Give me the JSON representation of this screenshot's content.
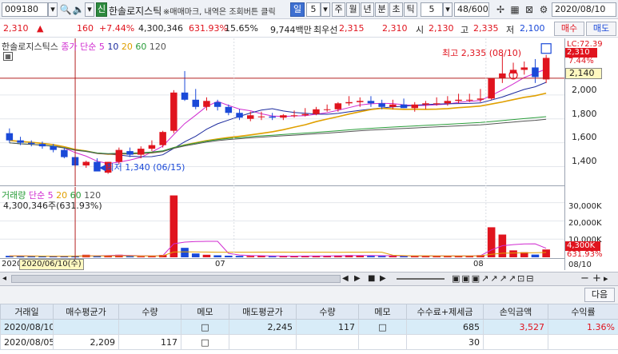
{
  "toolbar": {
    "code": "009180",
    "badge": "신",
    "name": "한솔로지스틱",
    "notice": "※매매마크, 내역은 조회버튼 클릭",
    "periods": [
      "일",
      "5",
      "주",
      "월",
      "년",
      "분",
      "초",
      "틱"
    ],
    "active_period": "일",
    "tick_value": "5",
    "count": "48/600",
    "date": "2020/08/10"
  },
  "price_row": {
    "price": "2,310",
    "arrow": "▲",
    "change": "160",
    "change_pct": "+7.44%",
    "volume": "4,300,346",
    "vol_pct": "631.93%",
    "turnover": "15.65%",
    "amount": "9,744백만",
    "best_ask_label": "최우선",
    "best_ask": "2,315",
    "best_bid": "2,310",
    "open_label": "시",
    "open": "2,130",
    "high_label": "고",
    "high": "2,335",
    "low_label": "저",
    "low": "2,100",
    "buy_btn": "매수",
    "sell_btn": "매도"
  },
  "price_pane": {
    "legend_name": "한솔로지스틱스",
    "legend_ma": "종가 단순",
    "ma_periods": [
      "5",
      "10",
      "20",
      "60",
      "120"
    ],
    "ma_colors": [
      "#d02bd0",
      "#1c2b9e",
      "#e0a000",
      "#2a9d3a",
      "#555555"
    ],
    "high_note": "최고 2,335 (08/10)",
    "low_note": "최저 1,340 (06/15)",
    "right_labels": {
      "lc": "LC:72.39",
      "cur": "2,310",
      "pct": "7.44%",
      "ref": "2,140"
    },
    "axis_ticks": [
      "2,000",
      "1,800",
      "1,600",
      "1,400"
    ]
  },
  "vol_pane": {
    "legend_name": "거래량",
    "legend_ma": "단순",
    "ma_periods": [
      "5",
      "20",
      "60",
      "120"
    ],
    "ma_colors": [
      "#d02bd0",
      "#e0a000",
      "#2a9d3a",
      "#555555"
    ],
    "cur_text": "4,300,346주(631.93%)",
    "axis_ticks": [
      "30,000K",
      "20,000K",
      "10,000K"
    ],
    "right_labels": {
      "cur": "4,300K",
      "pct": "631.93%"
    }
  },
  "time_axis": {
    "labels": [
      "2020",
      "07",
      "08"
    ],
    "cursor": "2020/06/10(수)",
    "right": "08/10"
  },
  "chart_data": {
    "type": "candlestick",
    "dates": [
      "06/02",
      "06/03",
      "06/04",
      "06/05",
      "06/08",
      "06/09",
      "06/10",
      "06/11",
      "06/12",
      "06/15",
      "06/16",
      "06/17",
      "06/18",
      "06/19",
      "06/22",
      "06/23",
      "06/24",
      "06/25",
      "06/26",
      "06/29",
      "06/30",
      "07/01",
      "07/02",
      "07/03",
      "07/06",
      "07/07",
      "07/08",
      "07/09",
      "07/10",
      "07/13",
      "07/14",
      "07/15",
      "07/16",
      "07/17",
      "07/20",
      "07/21",
      "07/22",
      "07/23",
      "07/24",
      "07/27",
      "07/28",
      "07/29",
      "07/30",
      "07/31",
      "08/03",
      "08/04",
      "08/05",
      "08/06",
      "08/07",
      "08/10"
    ],
    "open": [
      1680,
      1620,
      1600,
      1590,
      1570,
      1540,
      1480,
      1410,
      1440,
      1350,
      1440,
      1530,
      1500,
      1550,
      1580,
      1700,
      2020,
      1960,
      1900,
      1940,
      1900,
      1850,
      1800,
      1820,
      1820,
      1810,
      1830,
      1830,
      1840,
      1880,
      1880,
      1930,
      1940,
      1950,
      1930,
      1900,
      1920,
      1890,
      1920,
      1930,
      1930,
      1950,
      1960,
      1960,
      1970,
      2140,
      2180,
      2210,
      2230,
      2130
    ],
    "high": [
      1720,
      1650,
      1620,
      1610,
      1590,
      1560,
      1500,
      1450,
      1470,
      1440,
      1560,
      1560,
      1570,
      1620,
      1700,
      2040,
      2200,
      2050,
      1980,
      1960,
      1920,
      1880,
      1860,
      1860,
      1850,
      1840,
      1870,
      1890,
      1900,
      1920,
      1940,
      1990,
      1980,
      1990,
      1960,
      1960,
      1970,
      1940,
      1950,
      1980,
      1990,
      2010,
      2010,
      2050,
      2140,
      2340,
      2270,
      2280,
      2300,
      2335
    ],
    "low": [
      1600,
      1580,
      1570,
      1550,
      1520,
      1470,
      1400,
      1390,
      1380,
      1340,
      1420,
      1480,
      1470,
      1530,
      1560,
      1680,
      1950,
      1880,
      1870,
      1870,
      1830,
      1790,
      1780,
      1790,
      1790,
      1790,
      1810,
      1820,
      1830,
      1860,
      1860,
      1910,
      1900,
      1900,
      1880,
      1880,
      1890,
      1860,
      1880,
      1910,
      1910,
      1930,
      1940,
      1940,
      1960,
      2100,
      2140,
      2170,
      2100,
      2100
    ],
    "close": [
      1620,
      1600,
      1590,
      1570,
      1540,
      1480,
      1410,
      1440,
      1360,
      1440,
      1540,
      1500,
      1550,
      1580,
      1690,
      2020,
      1960,
      1900,
      1950,
      1900,
      1850,
      1810,
      1830,
      1820,
      1810,
      1830,
      1830,
      1840,
      1880,
      1880,
      1930,
      1940,
      1950,
      1930,
      1900,
      1920,
      1890,
      1920,
      1930,
      1930,
      1950,
      1960,
      1960,
      1970,
      2140,
      2180,
      2210,
      2230,
      2150,
      2310
    ],
    "volume": [
      800,
      700,
      600,
      550,
      500,
      650,
      900,
      1400,
      800,
      1100,
      1400,
      600,
      500,
      600,
      1300,
      34000,
      5200,
      2100,
      1400,
      1100,
      900,
      800,
      700,
      800,
      600,
      600,
      700,
      800,
      900,
      800,
      1000,
      1200,
      1000,
      800,
      700,
      800,
      700,
      800,
      800,
      700,
      800,
      800,
      900,
      1200,
      16500,
      12500,
      3800,
      2800,
      1500,
      4300
    ],
    "y_axis_ticks": [
      1400,
      1600,
      1800,
      2000
    ],
    "volume_axis_ticks": [
      10000,
      20000,
      30000
    ],
    "volume_unit": "K"
  },
  "scroll": {
    "more_btn": "다음"
  },
  "trade_table": {
    "headers": [
      "거래일",
      "매수평균가",
      "수량",
      "메모",
      "매도평균가",
      "수량",
      "메모",
      "수수료+제세금",
      "손익금액",
      "수익률"
    ],
    "rows": [
      [
        "2020/08/10",
        "",
        "",
        "□",
        "2,245",
        "117",
        "□",
        "685",
        "3,527",
        "1.36%"
      ],
      [
        "2020/08/05",
        "2,209",
        "117",
        "□",
        "",
        "",
        "",
        "30",
        "",
        ""
      ]
    ]
  }
}
